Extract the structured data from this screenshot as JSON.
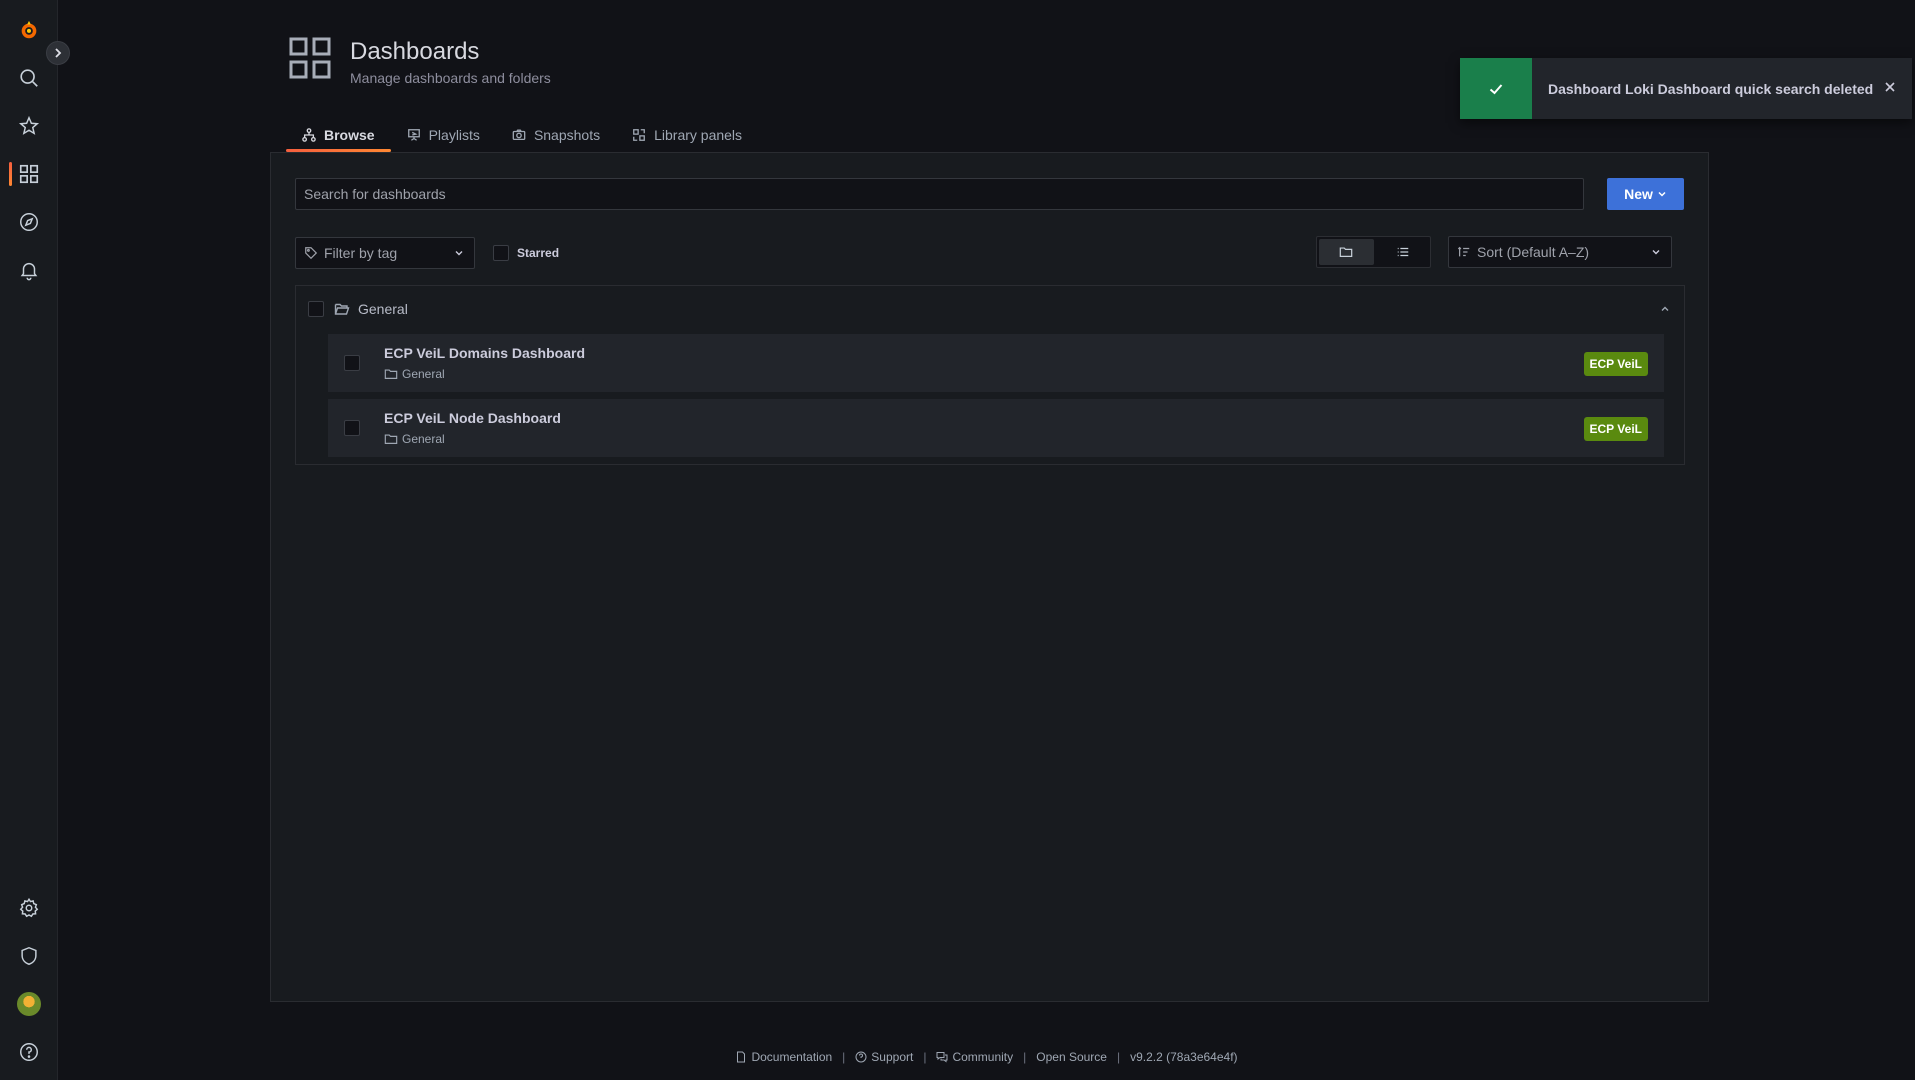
{
  "header": {
    "title": "Dashboards",
    "subtitle": "Manage dashboards and folders"
  },
  "tabs": [
    {
      "label": "Browse",
      "active": true
    },
    {
      "label": "Playlists"
    },
    {
      "label": "Snapshots"
    },
    {
      "label": "Library panels"
    }
  ],
  "search": {
    "placeholder": "Search for dashboards"
  },
  "new_button": {
    "label": "New"
  },
  "filter": {
    "placeholder": "Filter by tag"
  },
  "starred": {
    "label": "Starred"
  },
  "sort": {
    "label": "Sort (Default A–Z)"
  },
  "folder": {
    "name": "General",
    "dashboards": [
      {
        "title": "ECP VeiL Domains Dashboard",
        "folder": "General",
        "tag": "ECP VeiL"
      },
      {
        "title": "ECP VeiL Node Dashboard",
        "folder": "General",
        "tag": "ECP VeiL"
      }
    ]
  },
  "toast": {
    "message": "Dashboard Loki Dashboard quick search deleted"
  },
  "footer": {
    "documentation": "Documentation",
    "support": "Support",
    "community": "Community",
    "open_source": "Open Source",
    "version": "v9.2.2 (78a3e64e4f)",
    "separator": "|"
  },
  "colors": {
    "accent": "#f55f3e",
    "primary_button": "#3d71d9",
    "success": "#1a7f4b",
    "tag": "#5a8a0f"
  }
}
